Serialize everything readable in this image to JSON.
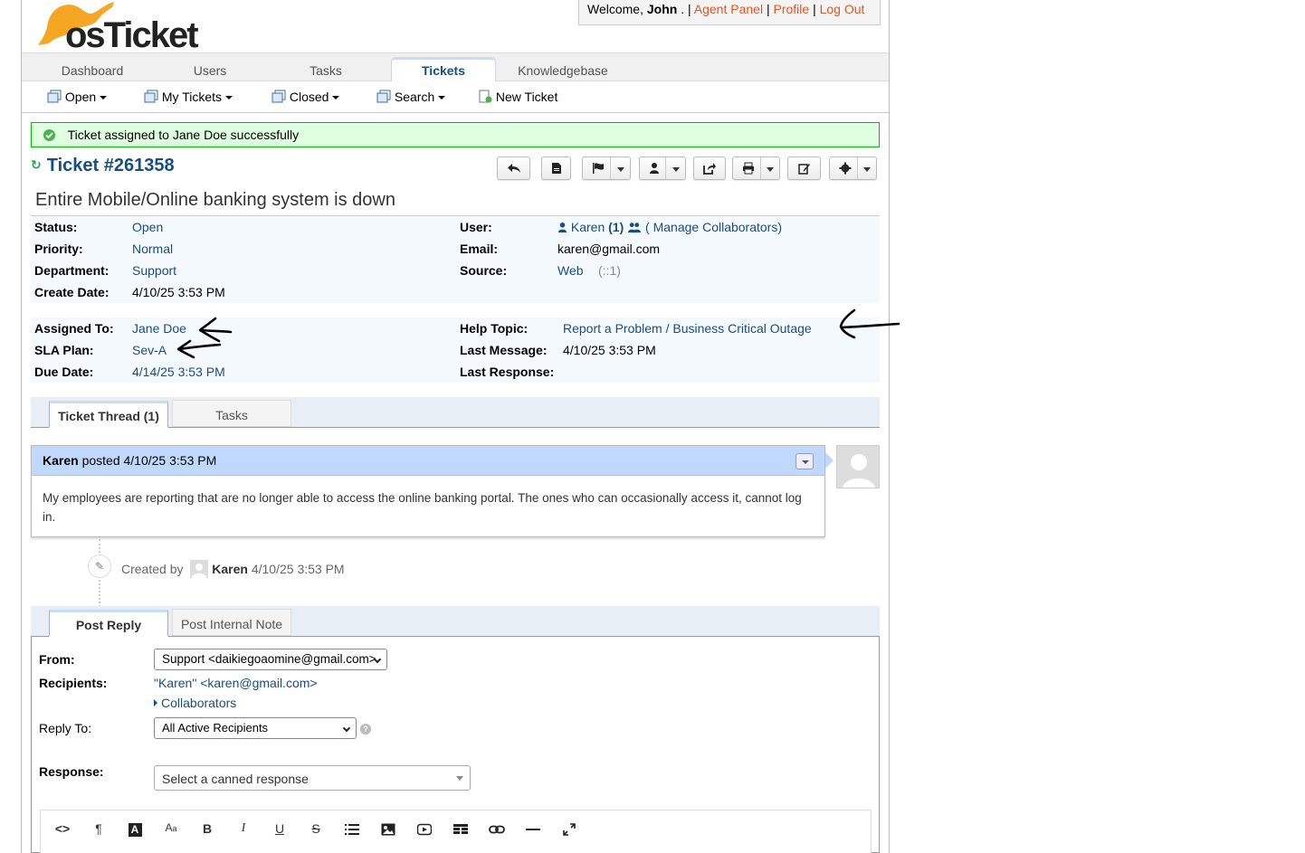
{
  "header": {
    "logo_text": "osTicket",
    "welcome": "Welcome,",
    "user_name": "John",
    "sep_dot": ". |",
    "agent_panel": "Agent Panel",
    "profile": "Profile",
    "logout": "Log Out",
    "pipe": "|"
  },
  "nav": {
    "tabs": [
      "Dashboard",
      "Users",
      "Tasks",
      "Tickets",
      "Knowledgebase"
    ],
    "active": "Tickets"
  },
  "subnav": {
    "items": [
      "Open",
      "My Tickets",
      "Closed",
      "Search",
      "New Ticket"
    ]
  },
  "notice": {
    "text": "Ticket assigned to Jane Doe successfully"
  },
  "ticket": {
    "number": "Ticket #261358",
    "subject": "Entire Mobile/Online banking system is down",
    "status_label": "Status:",
    "status": "Open",
    "priority_label": "Priority:",
    "priority": "Normal",
    "department_label": "Department:",
    "department": "Support",
    "create_label": "Create Date:",
    "create_date": "4/10/25 3:53 PM",
    "user_label": "User:",
    "user": "Karen",
    "user_count": "(1)",
    "manage_collab": "( Manage Collaborators)",
    "email_label": "Email:",
    "email": "karen@gmail.com",
    "source_label": "Source:",
    "source": "Web",
    "source_ip": "(::1)",
    "assigned_label": "Assigned To:",
    "assigned": "Jane Doe",
    "sla_label": "SLA Plan:",
    "sla": "Sev-A",
    "due_label": "Due Date:",
    "due": "4/14/25 3:53 PM",
    "topic_label": "Help Topic:",
    "topic": "Report a Problem / Business Critical Outage",
    "lastmsg_label": "Last Message:",
    "last_message": "4/10/25 3:53 PM",
    "lastresp_label": "Last Response:",
    "last_response": ""
  },
  "thread_tabs": [
    "Ticket Thread (1)",
    "Tasks"
  ],
  "entry": {
    "author": "Karen",
    "posted": "posted 4/10/25 3:53 PM",
    "body": "My employees are reporting that are no longer able to access the online banking portal. The ones who can occasionally access it, cannot log in."
  },
  "event": {
    "created_by": "Created by",
    "author": "Karen",
    "time": "4/10/25 3:53 PM"
  },
  "reply_tabs": [
    "Post Reply",
    "Post Internal Note"
  ],
  "reply": {
    "from_label": "From:",
    "from_value": "Support <daikiegoaomine@gmail.com>",
    "recipients_label": "Recipients:",
    "recipients_value": "\"Karen\" <karen@gmail.com>",
    "collaborators": "Collaborators",
    "replyto_label": "Reply To:",
    "replyto_value": "All Active Recipients",
    "response_label": "Response:",
    "canned_placeholder": "Select a canned response"
  },
  "colors": {
    "link": "#184E81",
    "accent_orange": "#E65524",
    "notice_bg": "#e0ffe0",
    "thread_header": "#c0d8fb"
  }
}
